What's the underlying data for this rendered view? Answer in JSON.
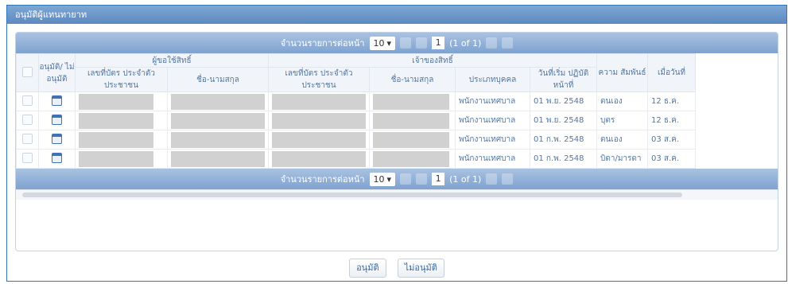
{
  "panel_title": "อนุมัติผู้แทนทายาท",
  "pager": {
    "label": "จำนวนรายการต่อหน้า",
    "per_page": "10",
    "page": "1",
    "of": "(1 of 1)"
  },
  "headers": {
    "select": "",
    "approve": "อนุมัติ/ ไม่อนุมัติ",
    "group_user": "ผู้ขอใช้สิทธิ์",
    "group_owner": "เจ้าของสิทธิ์",
    "id_card": "เลขที่บัตร ประจำตัวประชาชน",
    "name": "ชื่อ-นามสกุล",
    "person_type": "ประเภทบุคคล",
    "start_date": "วันที่เริ่ม ปฏิบัติหน้าที่",
    "relation": "ความ สัมพันธ์",
    "last": "เมื่อวันที่"
  },
  "rows": [
    {
      "person_type": "พนักงานเทศบาล",
      "start_date": "01 พ.ย. 2548",
      "relation": "ตนเอง",
      "last": "12 ธ.ค."
    },
    {
      "person_type": "พนักงานเทศบาล",
      "start_date": "01 พ.ย. 2548",
      "relation": "บุตร",
      "last": "12 ธ.ค."
    },
    {
      "person_type": "พนักงานเทศบาล",
      "start_date": "01 ก.พ. 2548",
      "relation": "ตนเอง",
      "last": "03 ส.ค."
    },
    {
      "person_type": "พนักงานเทศบาล",
      "start_date": "01 ก.พ. 2548",
      "relation": "บิดา/มารดา",
      "last": "03 ส.ค."
    }
  ],
  "buttons": {
    "approve": "อนุมัติ",
    "reject": "ไม่อนุมัติ"
  }
}
